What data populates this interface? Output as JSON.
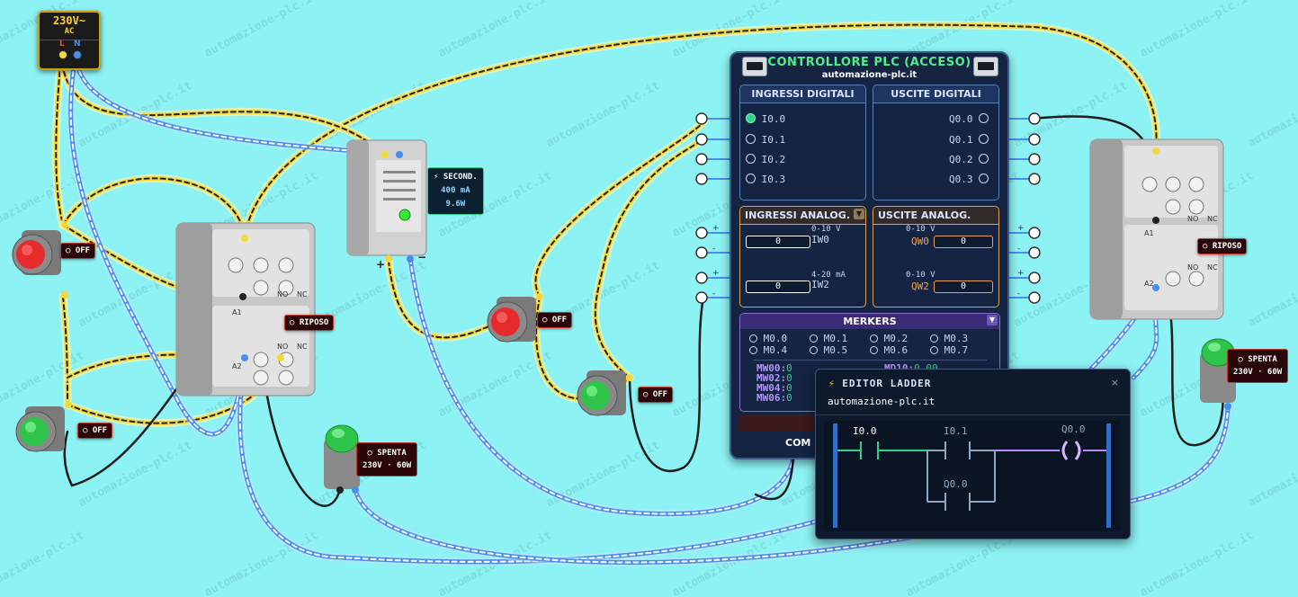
{
  "watermark": "automazione-plc.it",
  "supply": {
    "voltage": "230V~",
    "type": "AC",
    "l": "L",
    "n": "N"
  },
  "psu": {
    "line1": "⚡ SECOND.",
    "line2": "400 mA",
    "line3": "9.6W",
    "plus": "+",
    "minus": "−"
  },
  "buttons": {
    "off": "○ OFF"
  },
  "contactors": {
    "state": "○ RIPOSO"
  },
  "lamps": {
    "state": "○ SPENTA",
    "rating": "230V · 60W"
  },
  "plc": {
    "title": "CONTROLLORE PLC (ACCESO)",
    "subtitle": "automazione-plc.it",
    "digital_in": {
      "title": "INGRESSI DIGITALI",
      "items": [
        "I0.0",
        "I0.1",
        "I0.2",
        "I0.3"
      ],
      "active": [
        true,
        false,
        false,
        false
      ]
    },
    "digital_out": {
      "title": "USCITE DIGITALI",
      "items": [
        "Q0.0",
        "Q0.1",
        "Q0.2",
        "Q0.3"
      ]
    },
    "analog_in": {
      "title": "INGRESSI ANALOG.",
      "ch1": {
        "range": "0-10 V",
        "name": "IW0",
        "value": "0"
      },
      "ch2": {
        "range": "4-20 mA",
        "name": "IW2",
        "value": "0"
      }
    },
    "analog_out": {
      "title": "USCITE ANALOG.",
      "ch1": {
        "range": "0-10 V",
        "name": "QW0",
        "value": "0"
      },
      "ch2": {
        "range": "0-10 V",
        "name": "QW2",
        "value": "0"
      }
    },
    "merkers": {
      "title": "MERKERS",
      "items": [
        "M0.0",
        "M0.1",
        "M0.2",
        "M0.3",
        "M0.4",
        "M0.5",
        "M0.6",
        "M0.7"
      ],
      "words": [
        {
          "name": "MW00:",
          "value": "0"
        },
        {
          "name": "MW02:",
          "value": "0"
        },
        {
          "name": "MW04:",
          "value": "0"
        },
        {
          "name": "MW06:",
          "value": "0"
        }
      ],
      "md": {
        "name": "MD10:",
        "value": "0.00"
      }
    },
    "com": "COM",
    "plus": "+",
    "minus": "-"
  },
  "ladder": {
    "title": "⚡ EDITOR LADDER",
    "subtitle": "automazione-plc.it",
    "close": "×",
    "contact1": "I0.0",
    "contact2": "I0.1",
    "contact3": "Q0.0",
    "coil": "Q0.0"
  },
  "colors": {
    "background": "#8df2f3",
    "wire_yellow": "#f5d83a",
    "wire_blue": "#4a8df0",
    "wire_black": "#1e1e1e",
    "plc_bg": "#142442",
    "green": "#2fd08a"
  }
}
